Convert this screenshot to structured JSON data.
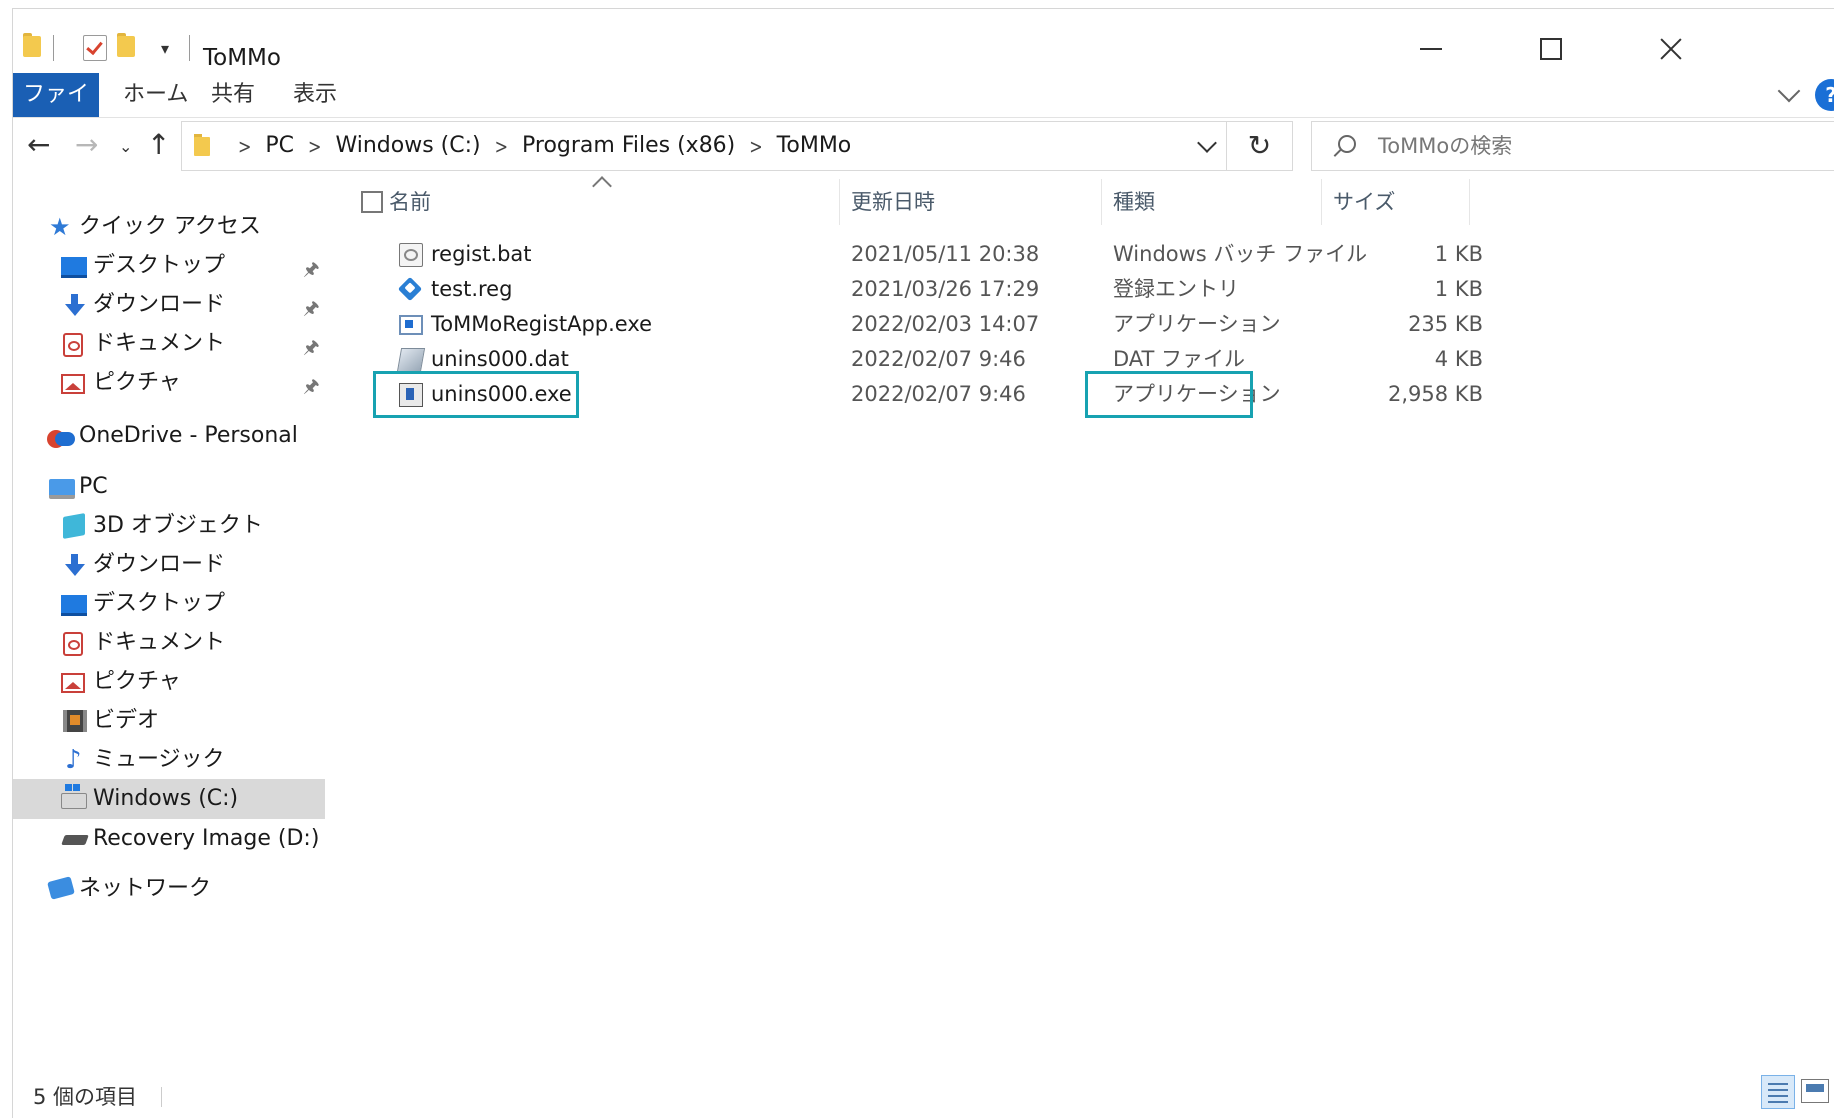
{
  "window": {
    "title": "ToMMo"
  },
  "ribbon": {
    "tabs": [
      {
        "label": "ファイル",
        "active": true
      },
      {
        "label": "ホーム"
      },
      {
        "label": "共有"
      },
      {
        "label": "表示"
      }
    ]
  },
  "address": {
    "crumbs": [
      "PC",
      "Windows (C:)",
      "Program Files (x86)",
      "ToMMo"
    ],
    "search_placeholder": "ToMMoの検索"
  },
  "nav": {
    "quick_access": "クイック アクセス",
    "quick_items": [
      {
        "label": "デスクトップ",
        "icon": "desktop-icon",
        "pinned": true
      },
      {
        "label": "ダウンロード",
        "icon": "download-icon",
        "pinned": true
      },
      {
        "label": "ドキュメント",
        "icon": "documents-icon",
        "pinned": true
      },
      {
        "label": "ピクチャ",
        "icon": "pictures-icon",
        "pinned": true
      }
    ],
    "onedrive": "OneDrive - Personal",
    "pc": "PC",
    "pc_items": [
      {
        "label": "3D オブジェクト",
        "icon": "3d-objects-icon"
      },
      {
        "label": "ダウンロード",
        "icon": "download-icon"
      },
      {
        "label": "デスクトップ",
        "icon": "desktop-icon"
      },
      {
        "label": "ドキュメント",
        "icon": "documents-icon"
      },
      {
        "label": "ピクチャ",
        "icon": "pictures-icon"
      },
      {
        "label": "ビデオ",
        "icon": "videos-icon"
      },
      {
        "label": "ミュージック",
        "icon": "music-icon"
      },
      {
        "label": "Windows (C:)",
        "icon": "drive-c-icon",
        "selected": true
      },
      {
        "label": "Recovery Image (D:)",
        "icon": "drive-d-icon"
      }
    ],
    "network": "ネットワーク"
  },
  "list": {
    "columns": {
      "name": "名前",
      "modified": "更新日時",
      "type": "種類",
      "size": "サイズ"
    },
    "files": [
      {
        "name": "regist.bat",
        "modified": "2021/05/11 20:38",
        "type": "Windows バッチ ファイル",
        "size": "1 KB",
        "icon": "batch-file-icon"
      },
      {
        "name": "test.reg",
        "modified": "2021/03/26 17:29",
        "type": "登録エントリ",
        "size": "1 KB",
        "icon": "registry-file-icon"
      },
      {
        "name": "ToMMoRegistApp.exe",
        "modified": "2022/02/03 14:07",
        "type": "アプリケーション",
        "size": "235 KB",
        "icon": "application-icon"
      },
      {
        "name": "unins000.dat",
        "modified": "2022/02/07 9:46",
        "type": "DAT ファイル",
        "size": "4 KB",
        "icon": "dat-file-icon"
      },
      {
        "name": "unins000.exe",
        "modified": "2022/02/07 9:46",
        "type": "アプリケーション",
        "size": "2,958 KB",
        "icon": "uninstaller-icon"
      }
    ],
    "highlighted_file": "unins000.exe",
    "highlight_color": "#17a2b1"
  },
  "status": {
    "item_count": "5 個の項目"
  },
  "colors": {
    "active_tab": "#1a5fb4",
    "selection": "#d9d9d9"
  }
}
